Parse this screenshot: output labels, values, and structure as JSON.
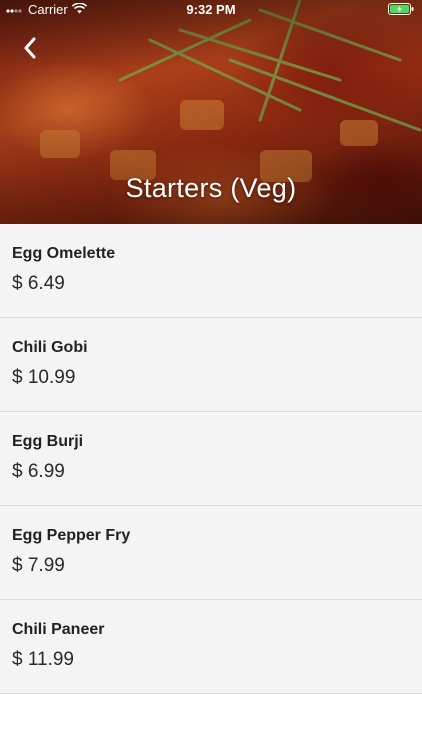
{
  "status_bar": {
    "carrier": "Carrier",
    "time": "9:32 PM",
    "wifi_icon": "wifi-icon",
    "battery_icon": "battery-charging-icon",
    "battery_color": "#4cd964"
  },
  "header": {
    "title": "Starters (Veg)",
    "back_icon": "chevron-left-icon",
    "title_color": "#ffffff"
  },
  "menu_items": [
    {
      "name": "Egg Omelette",
      "price": "$ 6.49"
    },
    {
      "name": "Chili Gobi",
      "price": "$ 10.99"
    },
    {
      "name": "Egg Burji",
      "price": "$ 6.99"
    },
    {
      "name": "Egg Pepper Fry",
      "price": "$ 7.99"
    },
    {
      "name": "Chili Paneer",
      "price": "$ 11.99"
    }
  ],
  "colors": {
    "list_background": "#f4f4f4",
    "divider": "#dcdcdc",
    "text_primary": "#222222"
  }
}
